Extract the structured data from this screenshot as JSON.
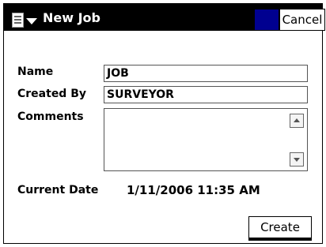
{
  "app": {
    "title": "New Job",
    "cancel_label": "Cancel",
    "menu_icon": "document-icon"
  },
  "form": {
    "name_label": "Name",
    "name_value": "JOB",
    "created_by_label": "Created By",
    "created_by_value": "SURVEYOR",
    "comments_label": "Comments",
    "comments_value": "",
    "current_date_label": "Current Date",
    "current_date_value": "1/11/2006 11:35 AM",
    "create_label": "Create"
  },
  "colors": {
    "titlebar": "#000000",
    "accent_box": "#000090"
  }
}
